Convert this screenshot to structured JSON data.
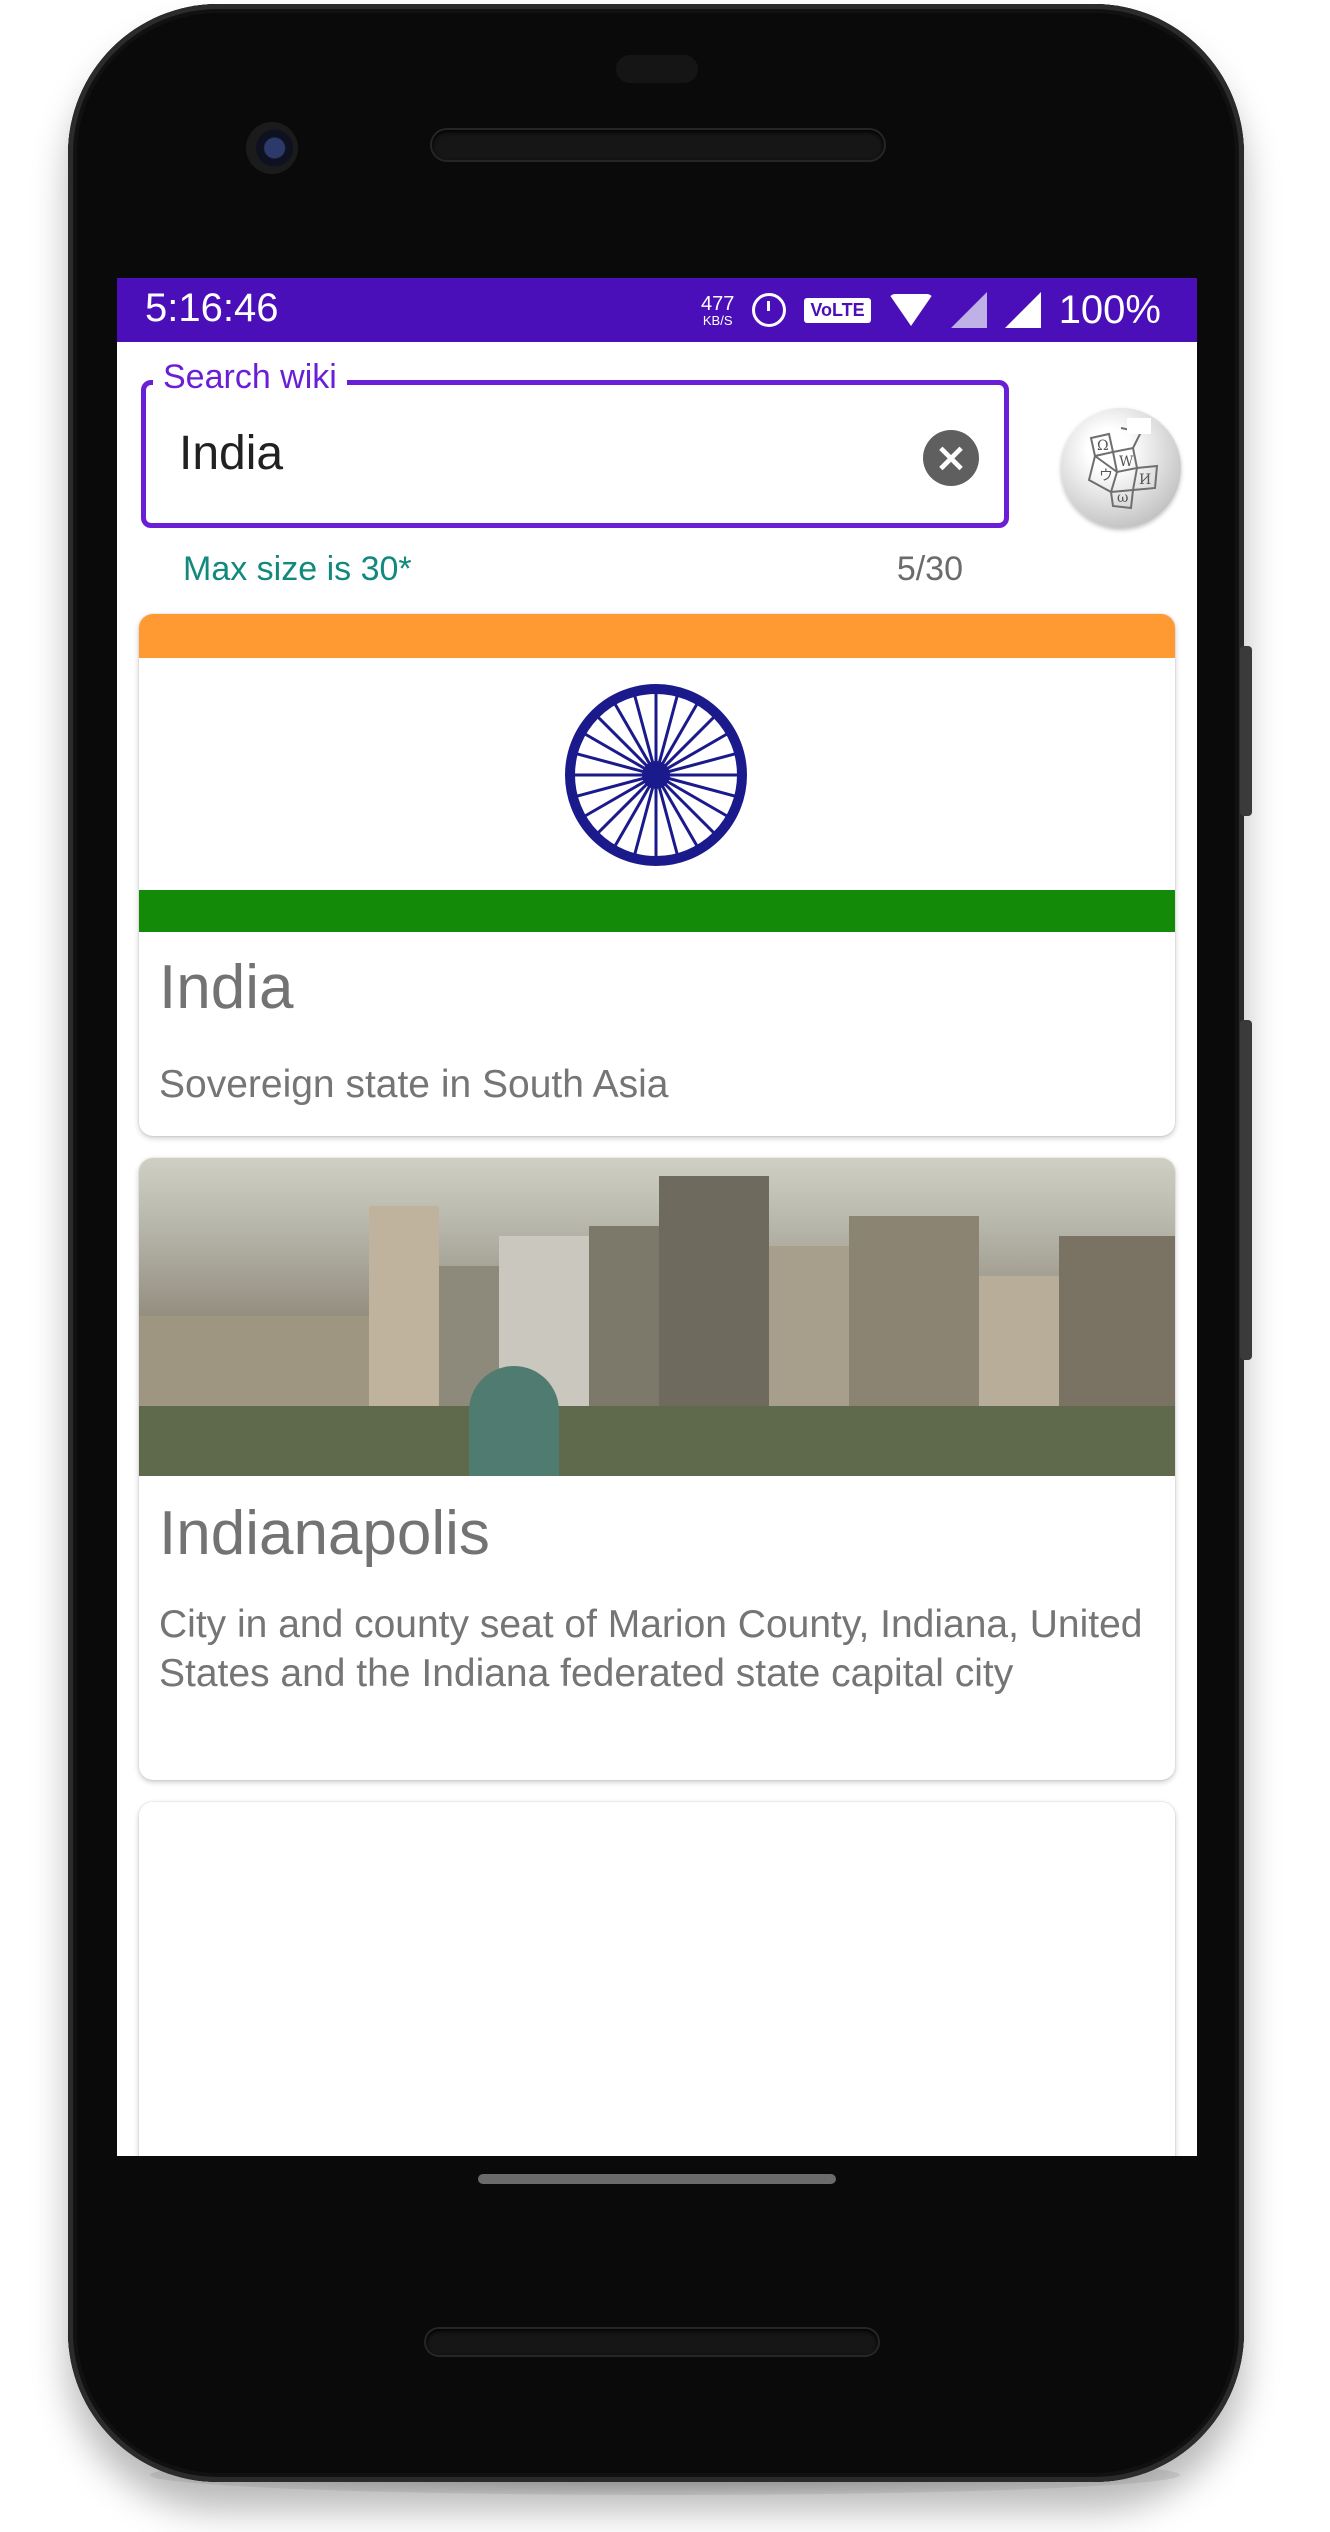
{
  "status_bar": {
    "time": "5:16:46",
    "net_speed_value": "477",
    "net_speed_unit": "KB/S",
    "volte_label": "VoLTE",
    "battery": "100%",
    "color": "#4a0fb8"
  },
  "search": {
    "label": "Search wiki",
    "value": "India",
    "helper": "Max size is 30*",
    "counter": "5/30",
    "accent": "#6a1fd6"
  },
  "results": [
    {
      "title": "India",
      "description": "Sovereign state in South Asia",
      "image": "flag-of-india"
    },
    {
      "title": "Indianapolis",
      "description": "City in and county seat of Marion County, Indiana, United States and the Indiana federated state capital city",
      "image": "indianapolis-skyline"
    },
    {
      "title": "",
      "description": "",
      "image": "congress-hand-logo"
    }
  ]
}
